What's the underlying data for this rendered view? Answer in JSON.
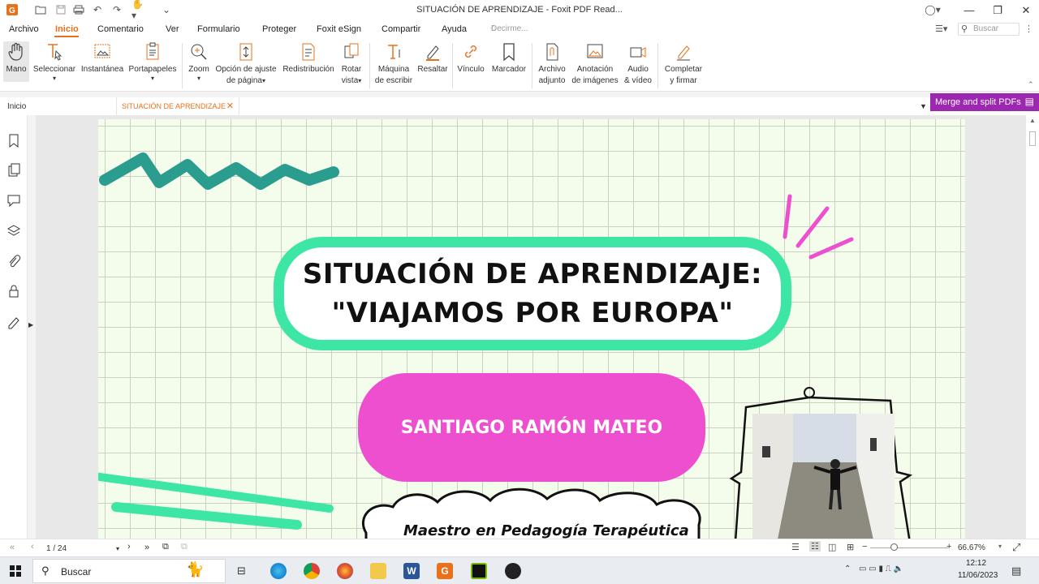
{
  "window": {
    "title": "SITUACIÓN DE APRENDIZAJE - Foxit PDF Read..."
  },
  "menu": {
    "items": [
      "Archivo",
      "Inicio",
      "Comentario",
      "Ver",
      "Formulario",
      "Proteger",
      "Foxit eSign",
      "Compartir",
      "Ayuda"
    ],
    "active": "Inicio",
    "tell_me_placeholder": "Decirme...",
    "search_placeholder": "Buscar"
  },
  "ribbon": {
    "tools": [
      {
        "label": "Mano",
        "icon": "hand-icon"
      },
      {
        "label": "Seleccionar",
        "icon": "select-text-icon"
      },
      {
        "label": "Instantánea",
        "icon": "snapshot-icon"
      },
      {
        "label": "Portapapeles",
        "icon": "clipboard-icon"
      },
      {
        "label": "Zoom",
        "icon": "zoom-icon"
      },
      {
        "label": "Opción de ajuste",
        "label2": "de página",
        "icon": "fit-page-icon"
      },
      {
        "label": "Redistribución",
        "icon": "reflow-icon"
      },
      {
        "label": "Rotar",
        "label2": "vista",
        "icon": "rotate-view-icon"
      },
      {
        "label": "Máquina",
        "label2": "de escribir",
        "icon": "typewriter-icon"
      },
      {
        "label": "Resaltar",
        "icon": "highlight-icon"
      },
      {
        "label": "Vínculo",
        "icon": "link-icon"
      },
      {
        "label": "Marcador",
        "icon": "bookmark-icon"
      },
      {
        "label": "Archivo",
        "label2": "adjunto",
        "icon": "attachment-icon"
      },
      {
        "label": "Anotación",
        "label2": "de imágenes",
        "icon": "image-annotation-icon"
      },
      {
        "label": "Audio",
        "label2": "& vídeo",
        "icon": "audio-video-icon"
      },
      {
        "label": "Completar",
        "label2": "y firmar",
        "icon": "fill-sign-icon"
      }
    ]
  },
  "tabs": {
    "home": "Inicio",
    "document": "SITUACIÓN DE APRENDIZAJE"
  },
  "promo": {
    "label": "Merge and split PDFs"
  },
  "document": {
    "title_line1": "SITUACIÓN DE APRENDIZAJE:",
    "title_line2": "\"VIAJAMOS POR EUROPA\"",
    "author": "SANTIAGO RAMÓN MATEO",
    "subtitle": "Maestro en Pedagogía Terapéutica"
  },
  "status": {
    "page": "1 / 24",
    "zoom": "66.67%"
  },
  "taskbar": {
    "search_label": "Buscar",
    "time": "12:12",
    "date": "11/06/2023"
  },
  "colors": {
    "accent": "#e8711b",
    "title_border": "#3de6a5",
    "author_bg": "#ee4fcf",
    "promo_bg": "#9c27b0",
    "page_bg": "#f4fcec"
  }
}
